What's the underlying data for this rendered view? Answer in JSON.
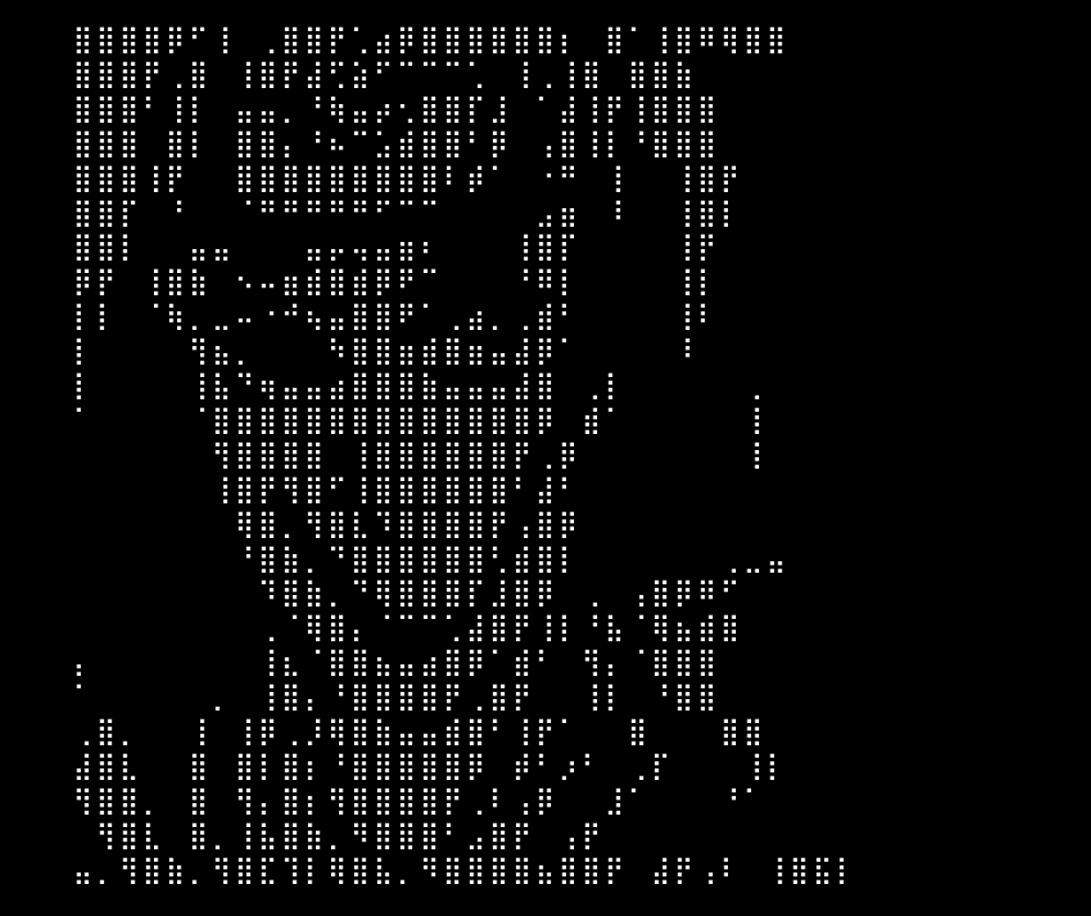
{
  "art": {
    "kind": "braille text-art portrait",
    "foreground": "#ffffff",
    "background": "#000000",
    "lines": [
      "⣿⣿⣿⣿⡿⠋⢸⠀⢀⣿⣿⡟⢁⣴⡿⣿⣿⣿⣿⣿⣿⡆⠀⣿⠁⢸⣿⠿⢿⣿⣿",
      "⣿⣿⣿⡟⢀⣿⠀⢸⣿⡟⣼⢋⣵⠋⠉⠉⠉⢁⠀⢸⢀⢸⣿⠀⣿⣿⣷",
      "⣿⣿⣿⠃⢸⡇⠀⣤⣤⡀⠘⢷⣤⡴⢂⣿⣿⡏⣸⠀⠁⣼⢸⡟⢸⣿⣿⣿",
      "⣿⣿⣿⠀⣿⡇⠀⣿⣿⡄⠘⠦⠉⣡⣾⣿⣿⠃⡿⠀⢠⣿⢸⡇⠘⣿⣿⣿",
      "⣿⣿⣿⢸⡟⠀⠀⣿⣿⣿⣿⣿⣿⣿⣿⣿⠇⡾⠁⠀⠐⠛⠀⢸⠀⠀⢸⣿⡟",
      "⣿⣿⡏⠀⠘⠀⠀⠈⠛⠛⠛⠛⠛⠋⠉⠉⠀⠀⠀⠀⣠⣶⠀⠸⠀⠀⢸⣿⡇",
      "⣿⣿⡇⠀⠀⣤⣤⠀⠀⠀⣤⡤⢤⣤⣶⠆⠀⠀⠀⢸⣿⡏⠀⠀⠀⠀⢸⡟",
      "⡿⡟⠀⢸⣿⣷⠀⠢⠤⣶⣾⣿⣾⡿⠟⠉⠀⠀⠀⠘⠿⡇⠀⠀⠀⠀⢸⡇",
      "⡇⡇⠀⠈⢷⡀⣀⠤⠐⠚⢦⣤⣿⣿⠟⠁⢀⣴⡀⢀⣾⠃⠀⠀⠀⠀⢸⠇",
      "⡇⠀⠀⠀⠀⢻⣦⡀⠀⠀⠀⠳⣿⣿⣶⣾⣿⣶⣤⣼⡿⠁⠀⠀⠀⠀⠸⠀",
      "⡇⠀⠀⠀⠀⢸⣧⠙⢶⣤⣤⣴⣿⣿⣿⣷⣤⣤⣤⣼⣿⠀⢀⡇⠀⠀⠀⠀⠀⢀",
      "⠁⠀⠀⠀⠀⠈⣿⣿⣿⣿⣿⣿⣿⣿⣿⣿⣿⣿⣿⣿⡿⠀⣾⠁⠀⠀⠀⠀⠀⢸",
      "⠀⠀⠀⠀⠀⠀⢻⣿⣿⣿⣿⠀⢸⣿⣿⣿⣿⣿⣿⡟⢀⡿⠀⠀⠀⠀⠀⠀⠀⢸",
      "⠀⠀⠀⠀⠀⠀⢸⣿⡟⢻⣿⠋⢸⣿⣿⣿⣿⣿⣿⠃⣼⠃",
      "⠀⠀⠀⠀⠀⠀⠀⢿⣿⡀⢻⣿⣇⠹⣿⣿⣿⣿⡟⢠⣿⡿",
      "⠀⠀⠀⠀⠀⠀⠀⠘⣿⣷⡀⠙⣿⣿⣿⣿⣿⣿⢃⣾⣿⡇⠀⠀⠀⠀⠀⠀⢀⣀⣤",
      "⠀⠀⠀⠀⠀⠀⠀⠀⠹⣿⣷⡀⠙⢿⣿⣿⣿⡏⣸⣿⡿⠀⢀⠀⢠⣿⡿⠿⠋",
      "⠀⠀⠀⠀⠀⠀⠀⠀⢀⠈⢿⣿⡄⠈⠉⠉⢁⣼⣿⡟⢸⡇⠘⣧⠈⢿⣦⣾⣿",
      "⡄⠀⠀⠀⠀⠀⠀⠀⢸⣆⠈⣿⣿⣦⣤⣴⣿⡿⠁⣾⠃⠀⢻⡄⠈⣿⣿⣿",
      "⠁⠀⠀⠀⠀⠀⡀⠀⢸⣿⡄⠘⣿⣿⣿⣿⡟⢀⣿⡟⠀⠀⢸⡇⠀⠘⣿⣿",
      "⢀⣿⡀⠀⠀⢸⠀⢸⡿⢀⡸⢿⣿⣷⣤⣤⣾⣿⠃⢸⡟⠁⠀⠀⣿⠀⠀⠀⣿⣿",
      "⣼⣿⣇⠀⠀⣿⠀⣿⡇⣿⡆⠘⣿⣿⣿⣿⣿⡿⠀⡾⠃⡰⠃⠀⢀⡏⠀⠀⠀⢸⡇",
      "⢻⣿⣿⡀⠀⣿⠀⢻⡄⣿⡆⢻⣿⣿⣿⣿⡟⢀⠇⢠⡿⠀⠀⣸⠁⠀⠀⠀⠘⠁",
      "⠀⢻⣿⣇⠀⣿⡀⢸⣧⣿⣷⡀⠻⣿⣿⣿⠃⣠⣿⡟⠀⢠⡟",
      "⣤⡀⢻⣿⣷⡀⢻⣿⣏⢹⡇⢿⣿⣧⡀⠻⣿⣿⣿⣿⣦⣿⣿⡟⠀⣼⡟⢠⠇⠀⢸⣿⣯⡇"
    ]
  }
}
